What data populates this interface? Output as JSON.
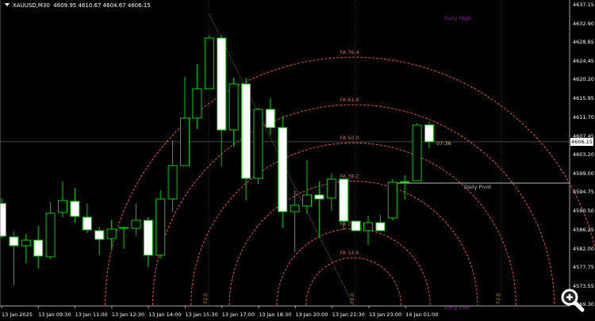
{
  "header": {
    "symbol": "XAUUSD,M30",
    "open": "4609.95",
    "high": "4610.67",
    "low": "4604.67",
    "close": "4606.15"
  },
  "price_axis": [
    "4637.15",
    "4632.90",
    "4628.65",
    "4624.45",
    "4620.20",
    "4615.95",
    "4611.70",
    "4607.45",
    "4603.20",
    "4599.00",
    "4594.75",
    "4590.50",
    "4586.25",
    "4582.00",
    "4577.75",
    "4573.55",
    "4569.30"
  ],
  "current_price": "4606.15",
  "time_axis": [
    "13 Jan 2025",
    "13 Jan 09:30",
    "13 Jan 11:00",
    "13 Jan 12:30",
    "13 Jan 14:00",
    "13 Jan 15:30",
    "13 Jan 17:00",
    "13 Jan 18:30",
    "13 Jan 20:00",
    "13 Jan 21:30",
    "13 Jan 23:00",
    "14 Jan 01:00"
  ],
  "levels": {
    "daily_high": "Daily High",
    "daily_low": "Daily Low",
    "daily_pivot": "Daily Pivot",
    "pivot_price": 4596.8
  },
  "bar_timer": "07:36",
  "fan": {
    "from_bar": 17,
    "from_price": 4634.97,
    "to_bar": 28.8,
    "to_price": 4569.21,
    "levels": [
      {
        "label": "FA 76.4",
        "ratio": 0.764
      },
      {
        "label": "FA 61.8",
        "ratio": 0.618
      },
      {
        "label": "FA 50.0",
        "ratio": 0.5
      },
      {
        "label": "FA 38.2",
        "ratio": 0.382
      },
      {
        "label": "FA 23.6",
        "ratio": 0.236
      },
      {
        "label": "FA 14.6",
        "ratio": 0.146
      }
    ]
  },
  "separator_labels": [
    "F2.0",
    "F2.0",
    "F2.0"
  ],
  "colors": {
    "bull": "#00d000",
    "bear_fill": "#ffffff",
    "fan": "#e0553a",
    "level_text": "#8a1a9a",
    "timer": "#d4d400"
  },
  "candles": [
    [
      4592.2,
      4593.4,
      4584.4,
      4584.8
    ],
    [
      4584.62,
      4585.87,
      4573.69,
      4582.65
    ],
    [
      4582.65,
      4585.34,
      4578.71,
      4583.9
    ],
    [
      4583.9,
      4587.13,
      4577.45,
      4580.32
    ],
    [
      4580.14,
      4592.5,
      4579.6,
      4590.0
    ],
    [
      4590.17,
      4597.16,
      4589.1,
      4592.86
    ],
    [
      4592.68,
      4595.73,
      4587.85,
      4589.28
    ],
    [
      4589.1,
      4592.15,
      4585.52,
      4586.23
    ],
    [
      4586.05,
      4586.95,
      4580.5,
      4584.08
    ],
    [
      4584.26,
      4588.38,
      4581.93,
      4586.41
    ],
    [
      4586.59,
      4586.77,
      4581.93,
      4586.77
    ],
    [
      4586.59,
      4592.15,
      4584.98,
      4588.38
    ],
    [
      4588.38,
      4589.1,
      4577.81,
      4580.5
    ],
    [
      4580.5,
      4595.19,
      4579.78,
      4593.22
    ],
    [
      4593.22,
      4606.48,
      4590.35,
      4600.75
    ],
    [
      4600.75,
      4620.82,
      4600.75,
      4611.5
    ],
    [
      4611.5,
      4623.68,
      4609.0,
      4618.13
    ],
    [
      4618.13,
      4630.3,
      4618.13,
      4629.6
    ],
    [
      4629.6,
      4630.32,
      4600.57,
      4608.81
    ],
    [
      4608.81,
      4620.64,
      4605.05,
      4619.21
    ],
    [
      4619.21,
      4620.64,
      4592.86,
      4597.88
    ],
    [
      4597.88,
      4613.83,
      4596.63,
      4613.47
    ],
    [
      4613.47,
      4615.98,
      4607.74,
      4609.35
    ],
    [
      4609.35,
      4612.04,
      4586.59,
      4590.35
    ],
    [
      4590.35,
      4595.19,
      4581.21,
      4591.79
    ],
    [
      4591.61,
      4602.0,
      4589.82,
      4594.12
    ],
    [
      4594.12,
      4597.16,
      4584.44,
      4593.22
    ],
    [
      4593.4,
      4598.96,
      4590.53,
      4597.7
    ],
    [
      4597.7,
      4597.7,
      4586.23,
      4588.2
    ],
    [
      4588.2,
      4588.2,
      4586.05,
      4586.05
    ],
    [
      4586.05,
      4589.46,
      4582.83,
      4587.85
    ],
    [
      4587.85,
      4589.64,
      4586.05,
      4586.05
    ],
    [
      4588.92,
      4597.7,
      4588.38,
      4596.98
    ],
    [
      4596.98,
      4598.6,
      4593.04,
      4597.16
    ],
    [
      4597.34,
      4610.42,
      4597.34,
      4609.89
    ],
    [
      4609.95,
      4610.67,
      4604.67,
      4606.15
    ]
  ]
}
